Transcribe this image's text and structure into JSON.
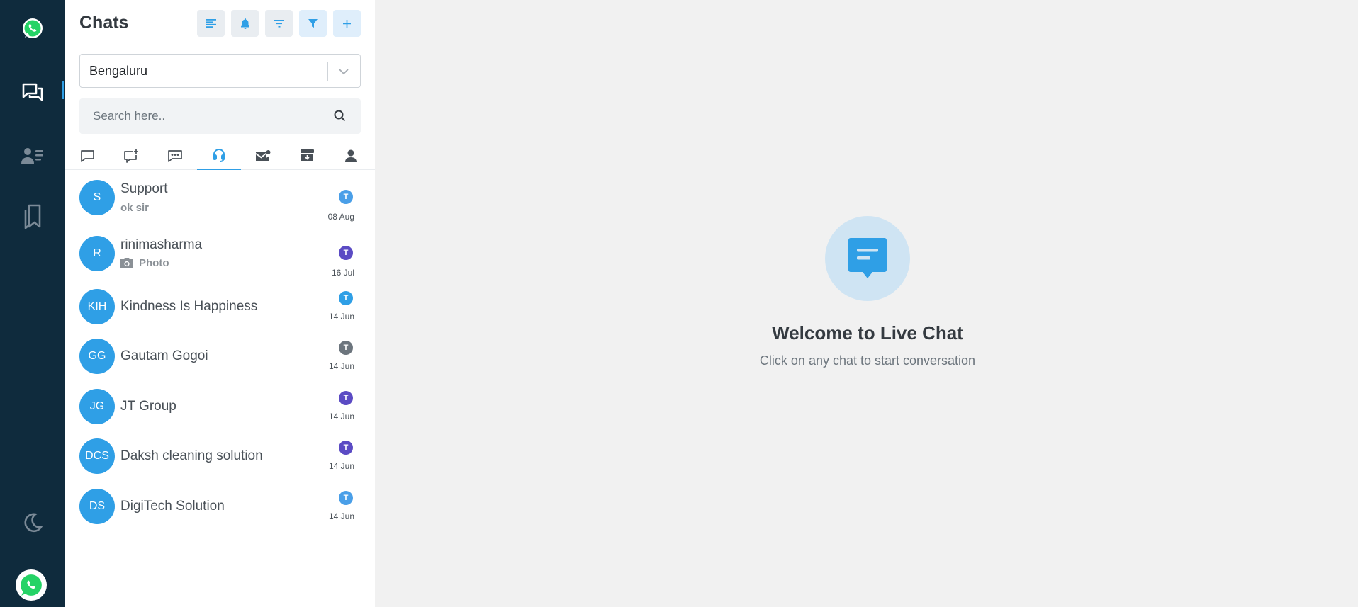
{
  "rail": {
    "icons": [
      "whatsapp-logo",
      "chats-icon",
      "contacts-icon",
      "bookmarks-icon",
      "moon-icon",
      "whatsapp-avatar"
    ],
    "accent": "#2f9fe6",
    "background": "#0f2b3d"
  },
  "panel": {
    "title": "Chats",
    "toolbar": [
      "align-left-icon",
      "bell-icon",
      "sort-icon",
      "funnel-icon",
      "plus-icon"
    ],
    "location_select": {
      "value": "Bengaluru"
    },
    "search": {
      "placeholder": "Search here.."
    },
    "tabs": [
      {
        "icon": "chat-square-icon",
        "active": false
      },
      {
        "icon": "chat-plus-icon",
        "active": false
      },
      {
        "icon": "chat-dots-icon",
        "active": false
      },
      {
        "icon": "headset-icon",
        "active": true
      },
      {
        "icon": "mail-icon",
        "active": false
      },
      {
        "icon": "archive-icon",
        "active": false
      },
      {
        "icon": "user-icon",
        "active": false
      }
    ]
  },
  "chats": [
    {
      "initials": "S",
      "name": "Support",
      "preview": "ok sir",
      "badge": "T",
      "badge_color": "#4a9fe8",
      "date": "08 Aug"
    },
    {
      "initials": "R",
      "name": "rinimasharma",
      "preview": "Photo",
      "preview_icon": "camera-icon",
      "badge": "T",
      "badge_color": "#5b4bc4",
      "date": "16 Jul"
    },
    {
      "initials": "KIH",
      "name": "Kindness Is Happiness",
      "preview": "",
      "badge": "T",
      "badge_color": "#2f9fe6",
      "date": "14 Jun"
    },
    {
      "initials": "GG",
      "name": "Gautam Gogoi",
      "preview": "",
      "badge": "T",
      "badge_color": "#6c757d",
      "date": "14 Jun"
    },
    {
      "initials": "JG",
      "name": "JT Group",
      "preview": "",
      "badge": "T",
      "badge_color": "#5b4bc4",
      "date": "14 Jun"
    },
    {
      "initials": "DCS",
      "name": "Daksh cleaning solution",
      "preview": "",
      "badge": "T",
      "badge_color": "#5b4bc4",
      "date": "14 Jun"
    },
    {
      "initials": "DS",
      "name": "DigiTech Solution",
      "preview": "",
      "badge": "T",
      "badge_color": "#4a9fe8",
      "date": "14 Jun"
    }
  ],
  "welcome": {
    "title": "Welcome to Live Chat",
    "subtitle": "Click on any chat to start conversation",
    "icon": "message-icon"
  }
}
